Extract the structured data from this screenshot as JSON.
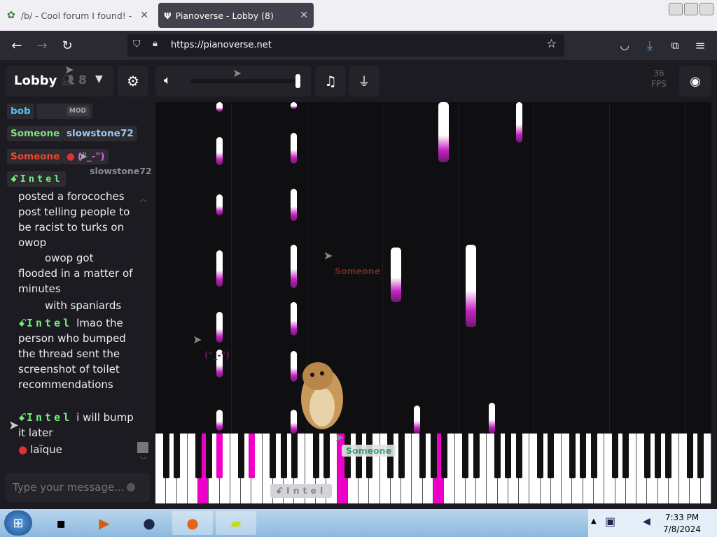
{
  "browser": {
    "tabs": [
      {
        "title": "/b/ - Cool forum I found! - Ran"
      },
      {
        "title": "Pianoverse - Lobby (8)"
      }
    ],
    "url": "https://pianoverse.net"
  },
  "header": {
    "room": "Lobby",
    "user_count": "8",
    "fps_value": "36",
    "fps_label": "FPS",
    "volume_level": 0.9
  },
  "users": [
    {
      "name": "bob",
      "color": "#4fc3f7"
    },
    {
      "name": "",
      "badge": "MOD"
    },
    {
      "name": "Someone",
      "color": "#7ee07e"
    },
    {
      "name": "slowstone72",
      "color": "#9ec8f2"
    },
    {
      "name": "Someone",
      "color": "#e8492f"
    },
    {
      "name": "(\"_-\")",
      "color": "#d066d8"
    },
    {
      "name": "Intel",
      "color": "#6ff07a"
    }
  ],
  "chat": {
    "messages": [
      {
        "author": "",
        "text": "posted a forocoches post telling people to be racist to turks on owop"
      },
      {
        "author": "",
        "text": "owop got flooded in a matter of minutes"
      },
      {
        "author": "",
        "text": "with spaniards"
      },
      {
        "author": "Intel",
        "text": "lmao the person who bumped the thread sent the screenshot of toilet recommendations"
      },
      {
        "author": "Intel",
        "text": "i will bump it later"
      },
      {
        "author": "",
        "text": "laïque"
      }
    ],
    "placeholder": "Type your message..."
  },
  "cursors": [
    {
      "label": "slowstone72",
      "color": "#8a8a98"
    },
    {
      "label": "Someone",
      "color": "#6b2a20"
    },
    {
      "label": "(\"_-\")",
      "color": "#5a1d5e"
    },
    {
      "label": "Someone",
      "color": "#38a06a"
    },
    {
      "label": "Intel",
      "color": "#a0a0a0"
    }
  ],
  "taskbar": {
    "time": "7:33 PM",
    "date": "7/8/2024"
  },
  "colors": {
    "note_accent": "#ee00c8",
    "intel": "#6ff07a"
  }
}
